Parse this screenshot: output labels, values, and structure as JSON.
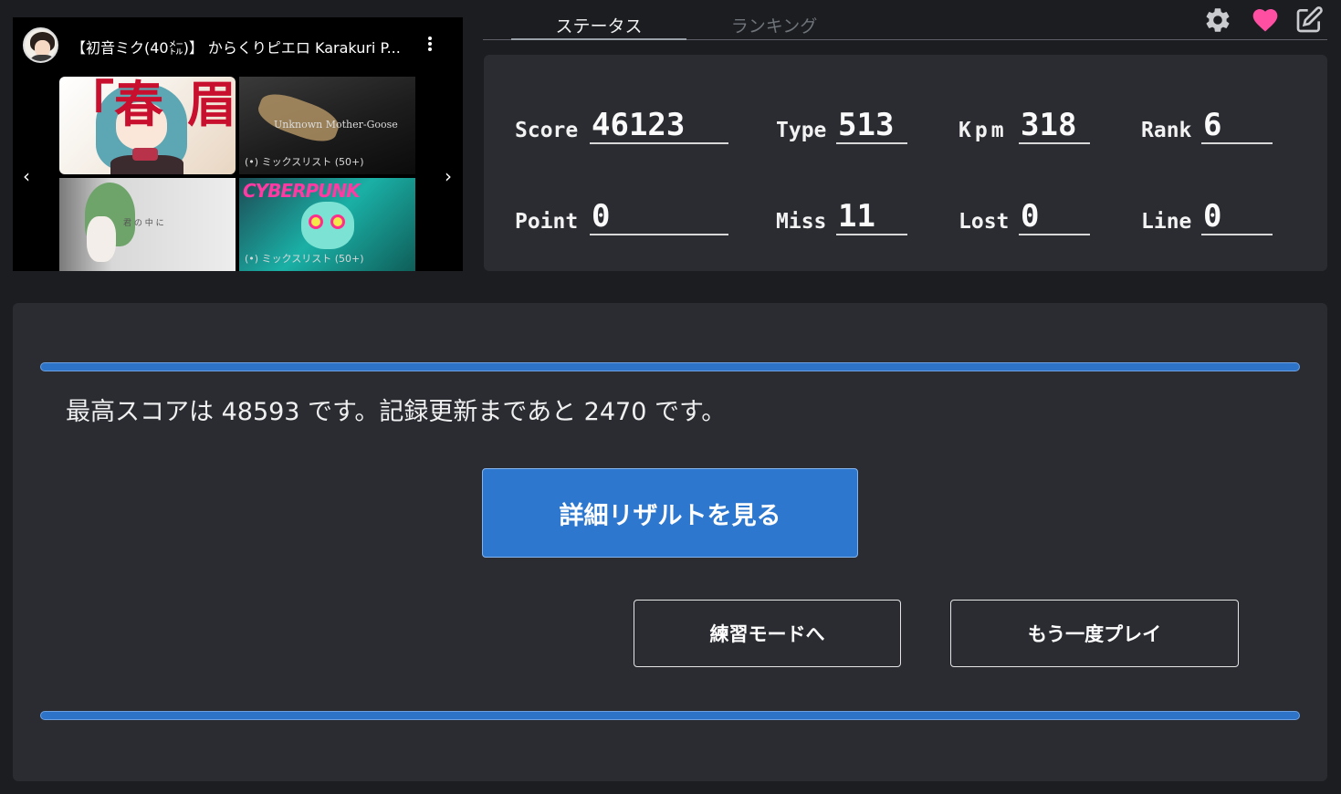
{
  "video": {
    "title": "【初音ミク(40㍍)】 からくりピエロ Karakuri P...",
    "thumbs": [
      {
        "label": "",
        "caption_top": "「春",
        "caption_side": "眉"
      },
      {
        "label": "(•) ミックスリスト (50+)",
        "overlay": "Unknown Mother-Goose"
      },
      {
        "label": "",
        "overlay": "君 の 中 に"
      },
      {
        "label": "(•) ミックスリスト (50+)",
        "overlay": "CYBERPUNK"
      }
    ],
    "prev_arrow": "‹",
    "next_arrow": "›"
  },
  "tabs": {
    "status": "ステータス",
    "ranking": "ランキング"
  },
  "icons": {
    "settings": "gear-icon",
    "favorite": "heart-icon",
    "edit": "edit-icon",
    "heart_color": "#ff4fa3"
  },
  "stats": {
    "score": {
      "label": "Score",
      "value": "46123"
    },
    "type": {
      "label": "Type",
      "value": "513"
    },
    "kpm": {
      "label": "Kpm",
      "value": "318"
    },
    "rank": {
      "label": "Rank",
      "value": "6"
    },
    "point": {
      "label": "Point",
      "value": "0"
    },
    "miss": {
      "label": "Miss",
      "value": "11"
    },
    "lost": {
      "label": "Lost",
      "value": "0"
    },
    "line": {
      "label": "Line",
      "value": "0"
    }
  },
  "result": {
    "best_message": "最高スコアは 48593 です。記録更新まであと 2470 です。",
    "detail_button": "詳細リザルトを見る",
    "practice_button": "練習モードへ",
    "replay_button": "もう一度プレイ"
  },
  "colors": {
    "accent": "#2d77ce",
    "background": "#1b1d21",
    "panel": "#2a2c32"
  }
}
